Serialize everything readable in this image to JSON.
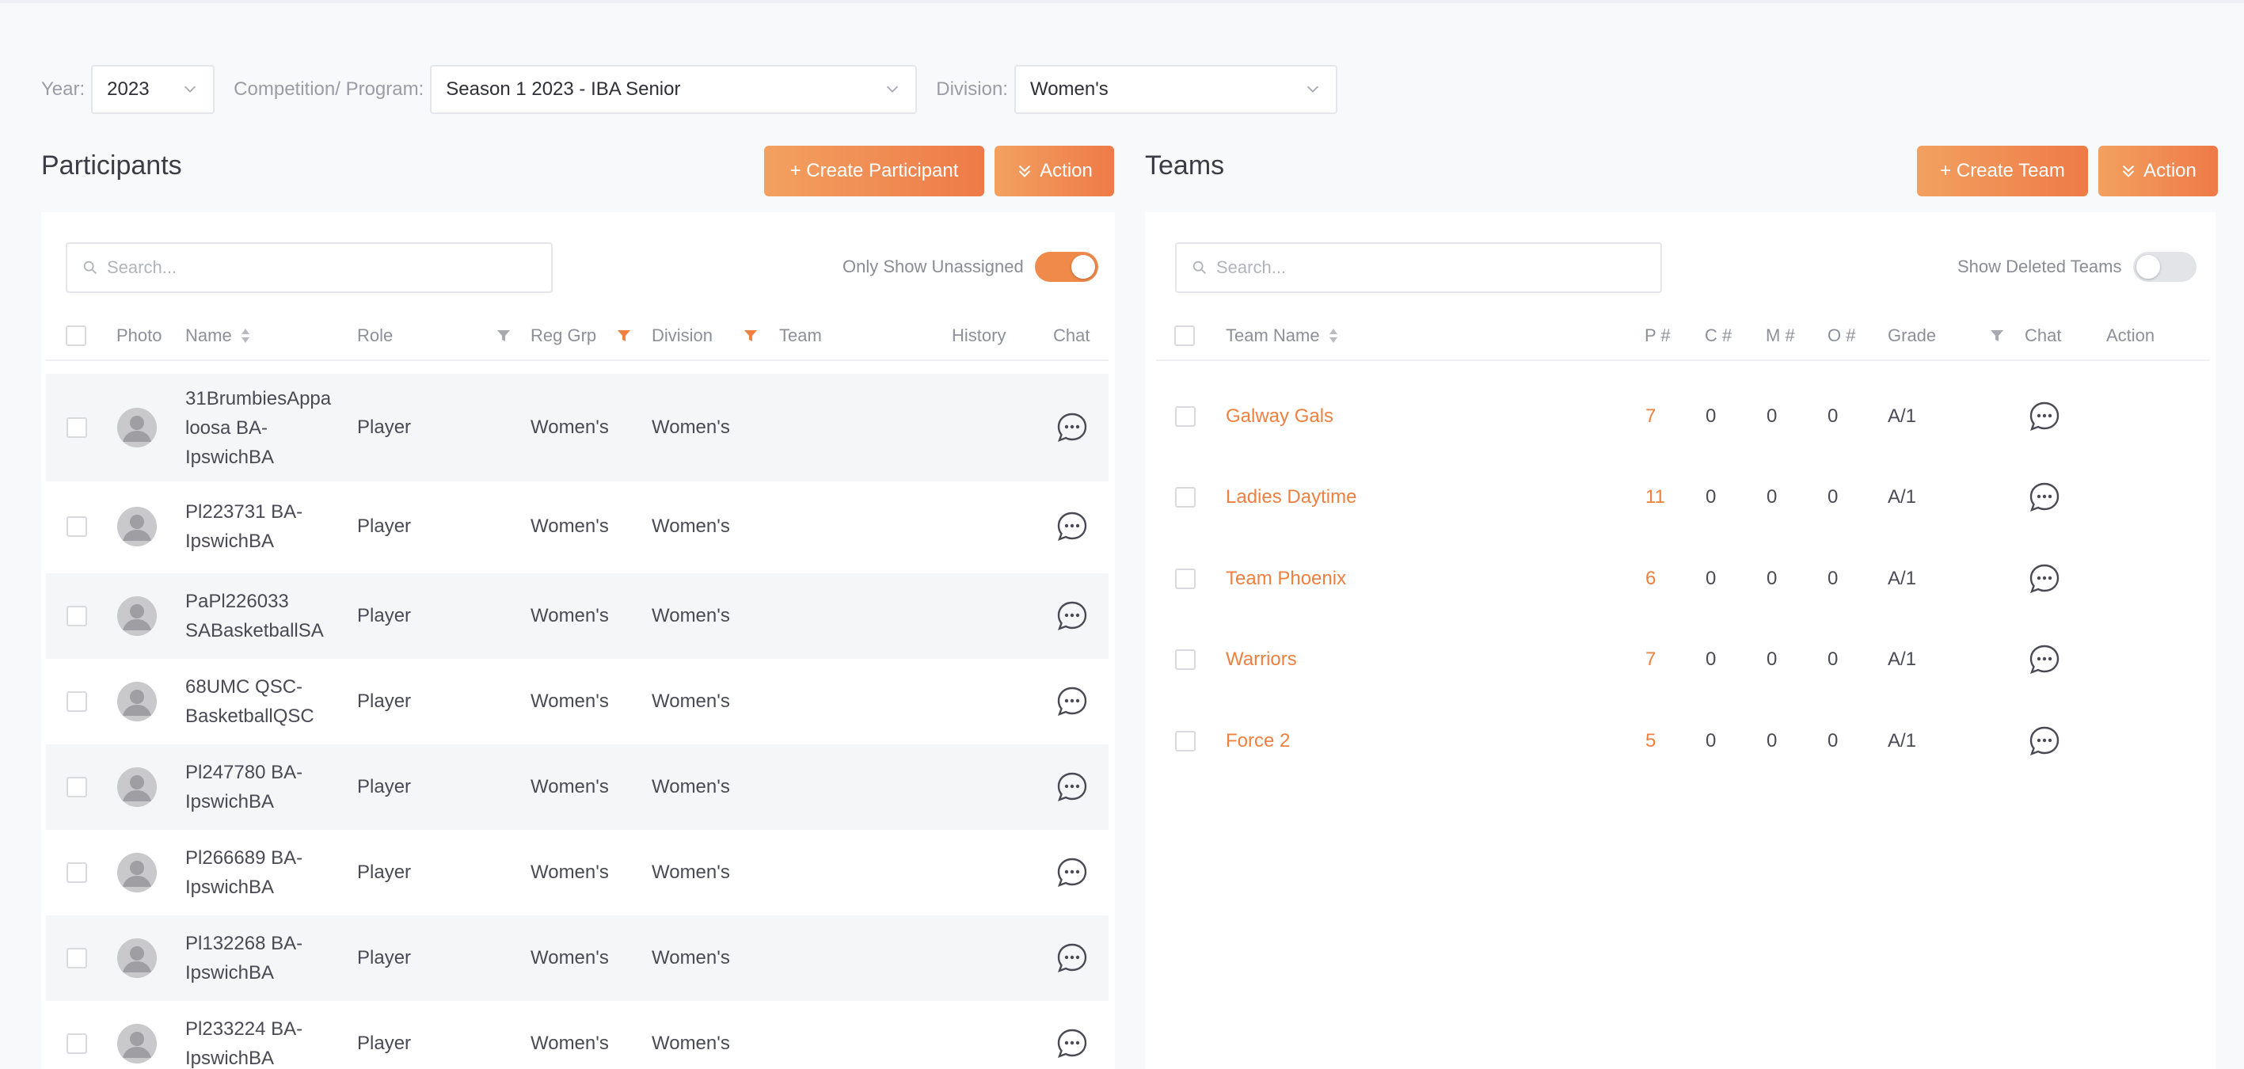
{
  "filters": {
    "year_label": "Year:",
    "year_value": "2023",
    "competition_label": "Competition/ Program:",
    "competition_value": "Season 1 2023 - IBA Senior",
    "division_label": "Division:",
    "division_value": "Women's"
  },
  "participants": {
    "title": "Participants",
    "create_label": "+ Create Participant",
    "action_label": "Action",
    "search_placeholder": "Search...",
    "toggle_label": "Only Show Unassigned",
    "columns": {
      "photo": "Photo",
      "name": "Name",
      "role": "Role",
      "reg_grp": "Reg Grp",
      "division": "Division",
      "team": "Team",
      "history": "History",
      "chat": "Chat"
    },
    "rows": [
      {
        "name_lines": [
          "31BrumbiesAppa",
          "loosa BA-",
          "IpswichBA"
        ],
        "role": "Player",
        "reg_grp": "Women's",
        "division": "Women's"
      },
      {
        "name_lines": [
          "Pl223731 BA-",
          "IpswichBA"
        ],
        "role": "Player",
        "reg_grp": "Women's",
        "division": "Women's"
      },
      {
        "name_lines": [
          "PaPl226033",
          "SABasketballSA"
        ],
        "role": "Player",
        "reg_grp": "Women's",
        "division": "Women's"
      },
      {
        "name_lines": [
          "68UMC QSC-",
          "BasketballQSC"
        ],
        "role": "Player",
        "reg_grp": "Women's",
        "division": "Women's"
      },
      {
        "name_lines": [
          "Pl247780 BA-",
          "IpswichBA"
        ],
        "role": "Player",
        "reg_grp": "Women's",
        "division": "Women's"
      },
      {
        "name_lines": [
          "Pl266689 BA-",
          "IpswichBA"
        ],
        "role": "Player",
        "reg_grp": "Women's",
        "division": "Women's"
      },
      {
        "name_lines": [
          "Pl132268 BA-",
          "IpswichBA"
        ],
        "role": "Player",
        "reg_grp": "Women's",
        "division": "Women's"
      },
      {
        "name_lines": [
          "Pl233224 BA-",
          "IpswichBA"
        ],
        "role": "Player",
        "reg_grp": "Women's",
        "division": "Women's"
      }
    ]
  },
  "teams": {
    "title": "Teams",
    "create_label": "+ Create Team",
    "action_label": "Action",
    "search_placeholder": "Search...",
    "toggle_label": "Show Deleted Teams",
    "columns": {
      "team_name": "Team Name",
      "p": "P #",
      "c": "C #",
      "m": "M #",
      "o": "O #",
      "grade": "Grade",
      "chat": "Chat",
      "action": "Action"
    },
    "rows": [
      {
        "name": "Galway Gals",
        "p": "7",
        "c": "0",
        "m": "0",
        "o": "0",
        "grade": "A/1"
      },
      {
        "name": "Ladies Daytime",
        "p": "11",
        "c": "0",
        "m": "0",
        "o": "0",
        "grade": "A/1"
      },
      {
        "name": "Team Phoenix",
        "p": "6",
        "c": "0",
        "m": "0",
        "o": "0",
        "grade": "A/1"
      },
      {
        "name": "Warriors",
        "p": "7",
        "c": "0",
        "m": "0",
        "o": "0",
        "grade": "A/1"
      },
      {
        "name": "Force 2",
        "p": "5",
        "c": "0",
        "m": "0",
        "o": "0",
        "grade": "A/1"
      }
    ]
  },
  "colors": {
    "accent": "#ee8040",
    "button_gradient_start": "#f2a160",
    "button_gradient_end": "#ee7a48",
    "alt_row": "#f5f6f8"
  },
  "icons": {
    "select_chevron": "chevron-down-icon",
    "search": "search-icon",
    "action_button": "double-chevron-down-icon",
    "column_sort": "sort-icon",
    "column_filter": "filter-icon",
    "avatar": "user-avatar-icon",
    "chat": "chat-bubble-icon"
  }
}
